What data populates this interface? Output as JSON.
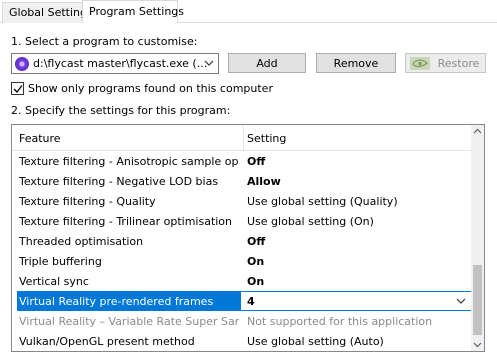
{
  "tabs": [
    {
      "label": "Global Settings",
      "active": false
    },
    {
      "label": "Program Settings",
      "active": true
    }
  ],
  "step1": {
    "label": "1. Select a program to customise:",
    "program_value": "d:\\flycast master\\flycast.exe (...",
    "program_icon": "flycast-app-icon",
    "add_label": "Add",
    "remove_label": "Remove",
    "restore_label": "Restore",
    "restore_enabled": false
  },
  "filter": {
    "label": "Show only programs found on this computer",
    "checked": true
  },
  "step2": {
    "label": "2. Specify the settings for this program:"
  },
  "grid": {
    "col_feature": "Feature",
    "col_setting": "Setting",
    "rows": [
      {
        "feature": "Texture filtering - Anisotropic sample opti...",
        "setting": "Off",
        "bold": true
      },
      {
        "feature": "Texture filtering - Negative LOD bias",
        "setting": "Allow",
        "bold": true
      },
      {
        "feature": "Texture filtering - Quality",
        "setting": "Use global setting (Quality)",
        "bold": false
      },
      {
        "feature": "Texture filtering - Trilinear optimisation",
        "setting": "Use global setting (On)",
        "bold": false
      },
      {
        "feature": "Threaded optimisation",
        "setting": "Off",
        "bold": true
      },
      {
        "feature": "Triple buffering",
        "setting": "On",
        "bold": true
      },
      {
        "feature": "Vertical sync",
        "setting": "On",
        "bold": true
      },
      {
        "feature": "Virtual Reality pre-rendered frames",
        "setting": "4",
        "bold": true,
        "selected": true
      },
      {
        "feature": "Virtual Reality – Variable Rate Super Samp...",
        "setting": "Not supported for this application",
        "bold": false,
        "disabled": true
      },
      {
        "feature": "Vulkan/OpenGL present method",
        "setting": "Use global setting (Auto)",
        "bold": false
      }
    ]
  },
  "colors": {
    "selection": "#0078d7",
    "nvidia_green": "#76b900"
  }
}
